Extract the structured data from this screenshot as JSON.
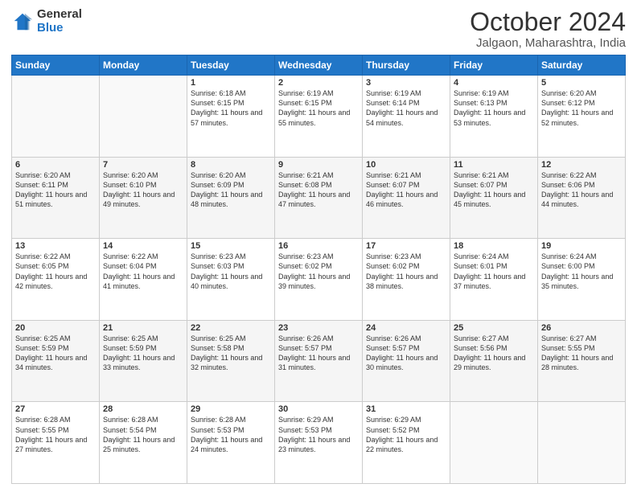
{
  "logo": {
    "general": "General",
    "blue": "Blue"
  },
  "header": {
    "month": "October 2024",
    "location": "Jalgaon, Maharashtra, India"
  },
  "weekdays": [
    "Sunday",
    "Monday",
    "Tuesday",
    "Wednesday",
    "Thursday",
    "Friday",
    "Saturday"
  ],
  "weeks": [
    [
      {
        "day": "",
        "info": ""
      },
      {
        "day": "",
        "info": ""
      },
      {
        "day": "1",
        "info": "Sunrise: 6:18 AM\nSunset: 6:15 PM\nDaylight: 11 hours and 57 minutes."
      },
      {
        "day": "2",
        "info": "Sunrise: 6:19 AM\nSunset: 6:15 PM\nDaylight: 11 hours and 55 minutes."
      },
      {
        "day": "3",
        "info": "Sunrise: 6:19 AM\nSunset: 6:14 PM\nDaylight: 11 hours and 54 minutes."
      },
      {
        "day": "4",
        "info": "Sunrise: 6:19 AM\nSunset: 6:13 PM\nDaylight: 11 hours and 53 minutes."
      },
      {
        "day": "5",
        "info": "Sunrise: 6:20 AM\nSunset: 6:12 PM\nDaylight: 11 hours and 52 minutes."
      }
    ],
    [
      {
        "day": "6",
        "info": "Sunrise: 6:20 AM\nSunset: 6:11 PM\nDaylight: 11 hours and 51 minutes."
      },
      {
        "day": "7",
        "info": "Sunrise: 6:20 AM\nSunset: 6:10 PM\nDaylight: 11 hours and 49 minutes."
      },
      {
        "day": "8",
        "info": "Sunrise: 6:20 AM\nSunset: 6:09 PM\nDaylight: 11 hours and 48 minutes."
      },
      {
        "day": "9",
        "info": "Sunrise: 6:21 AM\nSunset: 6:08 PM\nDaylight: 11 hours and 47 minutes."
      },
      {
        "day": "10",
        "info": "Sunrise: 6:21 AM\nSunset: 6:07 PM\nDaylight: 11 hours and 46 minutes."
      },
      {
        "day": "11",
        "info": "Sunrise: 6:21 AM\nSunset: 6:07 PM\nDaylight: 11 hours and 45 minutes."
      },
      {
        "day": "12",
        "info": "Sunrise: 6:22 AM\nSunset: 6:06 PM\nDaylight: 11 hours and 44 minutes."
      }
    ],
    [
      {
        "day": "13",
        "info": "Sunrise: 6:22 AM\nSunset: 6:05 PM\nDaylight: 11 hours and 42 minutes."
      },
      {
        "day": "14",
        "info": "Sunrise: 6:22 AM\nSunset: 6:04 PM\nDaylight: 11 hours and 41 minutes."
      },
      {
        "day": "15",
        "info": "Sunrise: 6:23 AM\nSunset: 6:03 PM\nDaylight: 11 hours and 40 minutes."
      },
      {
        "day": "16",
        "info": "Sunrise: 6:23 AM\nSunset: 6:02 PM\nDaylight: 11 hours and 39 minutes."
      },
      {
        "day": "17",
        "info": "Sunrise: 6:23 AM\nSunset: 6:02 PM\nDaylight: 11 hours and 38 minutes."
      },
      {
        "day": "18",
        "info": "Sunrise: 6:24 AM\nSunset: 6:01 PM\nDaylight: 11 hours and 37 minutes."
      },
      {
        "day": "19",
        "info": "Sunrise: 6:24 AM\nSunset: 6:00 PM\nDaylight: 11 hours and 35 minutes."
      }
    ],
    [
      {
        "day": "20",
        "info": "Sunrise: 6:25 AM\nSunset: 5:59 PM\nDaylight: 11 hours and 34 minutes."
      },
      {
        "day": "21",
        "info": "Sunrise: 6:25 AM\nSunset: 5:59 PM\nDaylight: 11 hours and 33 minutes."
      },
      {
        "day": "22",
        "info": "Sunrise: 6:25 AM\nSunset: 5:58 PM\nDaylight: 11 hours and 32 minutes."
      },
      {
        "day": "23",
        "info": "Sunrise: 6:26 AM\nSunset: 5:57 PM\nDaylight: 11 hours and 31 minutes."
      },
      {
        "day": "24",
        "info": "Sunrise: 6:26 AM\nSunset: 5:57 PM\nDaylight: 11 hours and 30 minutes."
      },
      {
        "day": "25",
        "info": "Sunrise: 6:27 AM\nSunset: 5:56 PM\nDaylight: 11 hours and 29 minutes."
      },
      {
        "day": "26",
        "info": "Sunrise: 6:27 AM\nSunset: 5:55 PM\nDaylight: 11 hours and 28 minutes."
      }
    ],
    [
      {
        "day": "27",
        "info": "Sunrise: 6:28 AM\nSunset: 5:55 PM\nDaylight: 11 hours and 27 minutes."
      },
      {
        "day": "28",
        "info": "Sunrise: 6:28 AM\nSunset: 5:54 PM\nDaylight: 11 hours and 25 minutes."
      },
      {
        "day": "29",
        "info": "Sunrise: 6:28 AM\nSunset: 5:53 PM\nDaylight: 11 hours and 24 minutes."
      },
      {
        "day": "30",
        "info": "Sunrise: 6:29 AM\nSunset: 5:53 PM\nDaylight: 11 hours and 23 minutes."
      },
      {
        "day": "31",
        "info": "Sunrise: 6:29 AM\nSunset: 5:52 PM\nDaylight: 11 hours and 22 minutes."
      },
      {
        "day": "",
        "info": ""
      },
      {
        "day": "",
        "info": ""
      }
    ]
  ]
}
